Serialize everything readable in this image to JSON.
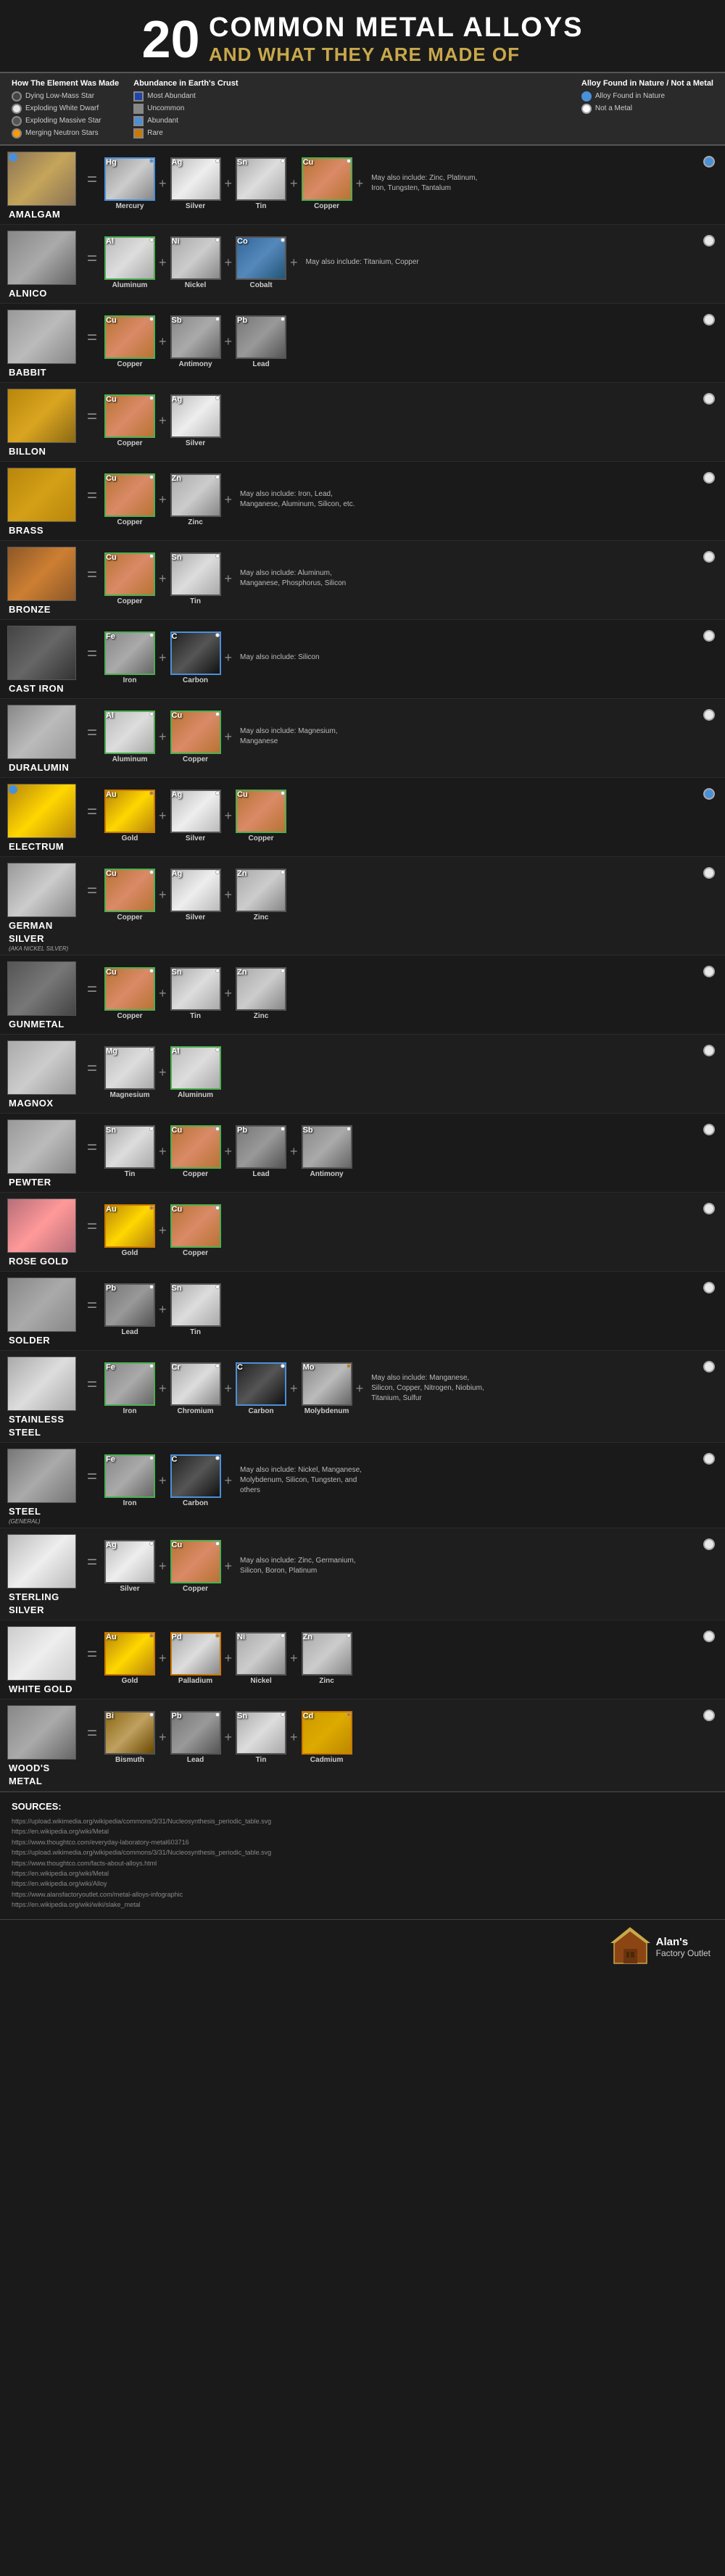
{
  "header": {
    "number": "20",
    "line1": "Common Metal Alloys",
    "line2": "And What They Are Made Of"
  },
  "legend": {
    "how_made_title": "How The Element Was Made",
    "items_how": [
      {
        "label": "Dying Low-Mass Star",
        "class": "lc-dying"
      },
      {
        "label": "Exploding White Dwarf",
        "class": "lc-dwarf"
      },
      {
        "label": "Exploding Massive Star",
        "class": "lc-massive"
      },
      {
        "label": "Merging Neutron Stars",
        "class": "lc-neutron"
      }
    ],
    "abundance_title": "Abundance in Earth's Crust",
    "items_abundance": [
      {
        "label": "Most Abundant",
        "class": "lb-most"
      },
      {
        "label": "Uncommon",
        "class": "lb-uncommon"
      },
      {
        "label": "Abundant",
        "class": "lb-abundant"
      },
      {
        "label": "Rare",
        "class": "lb-rare"
      }
    ],
    "alloy_found_title": "Alloy Found in Nature",
    "alloy_not_metal": "Not a Metal"
  },
  "alloys": [
    {
      "name": "AMALGAM",
      "subtitle": "",
      "texture": "tex-amalgam",
      "found_nature": true,
      "components": [
        {
          "symbol": "Hg",
          "name": "Mercury",
          "texture": "tex-mercury",
          "border": "border-blue",
          "dots": [
            "blue"
          ]
        },
        {
          "symbol": "Ag",
          "name": "Silver",
          "texture": "tex-silver",
          "border": "border-gray",
          "dots": [
            "white"
          ]
        },
        {
          "symbol": "Sn",
          "name": "Tin",
          "texture": "tex-tin",
          "border": "border-gray",
          "dots": [
            "white"
          ]
        },
        {
          "symbol": "Cu",
          "name": "Copper",
          "texture": "tex-copper",
          "border": "border-green",
          "dots": [
            "white"
          ]
        }
      ],
      "note": "May also include: Zinc, Platinum, Iron, Tungsten, Tantalum"
    },
    {
      "name": "ALNICO",
      "subtitle": "",
      "texture": "tex-alnico",
      "found_nature": false,
      "components": [
        {
          "symbol": "Al",
          "name": "Aluminum",
          "texture": "tex-aluminum",
          "border": "border-green",
          "dots": [
            "white"
          ]
        },
        {
          "symbol": "Ni",
          "name": "Nickel",
          "texture": "tex-nickel",
          "border": "border-gray",
          "dots": [
            "white"
          ]
        },
        {
          "symbol": "Co",
          "name": "Cobalt",
          "texture": "tex-cobalt",
          "border": "border-gray",
          "dots": [
            "white"
          ]
        }
      ],
      "note": "May also include: Titanium, Copper"
    },
    {
      "name": "BABBIT",
      "subtitle": "",
      "texture": "tex-babbit",
      "found_nature": false,
      "components": [
        {
          "symbol": "Cu",
          "name": "Copper",
          "texture": "tex-copper",
          "border": "border-green",
          "dots": [
            "white"
          ]
        },
        {
          "symbol": "Sb",
          "name": "Antimony",
          "texture": "tex-antimony",
          "border": "border-gray",
          "dots": [
            "white"
          ]
        },
        {
          "symbol": "Pb",
          "name": "Lead",
          "texture": "tex-lead",
          "border": "border-gray",
          "dots": [
            "white"
          ]
        }
      ],
      "note": ""
    },
    {
      "name": "BILLON",
      "subtitle": "",
      "texture": "tex-billon",
      "found_nature": false,
      "components": [
        {
          "symbol": "Cu",
          "name": "Copper",
          "texture": "tex-copper",
          "border": "border-green",
          "dots": [
            "white"
          ]
        },
        {
          "symbol": "Ag",
          "name": "Silver",
          "texture": "tex-silver",
          "border": "border-gray",
          "dots": [
            "white"
          ]
        }
      ],
      "note": ""
    },
    {
      "name": "BRASS",
      "subtitle": "",
      "texture": "tex-brass",
      "found_nature": false,
      "components": [
        {
          "symbol": "Cu",
          "name": "Copper",
          "texture": "tex-copper",
          "border": "border-green",
          "dots": [
            "white"
          ]
        },
        {
          "symbol": "Zn",
          "name": "Zinc",
          "texture": "tex-zinc",
          "border": "border-gray",
          "dots": [
            "white"
          ]
        }
      ],
      "note": "May also include: Iron, Lead, Manganese, Aluminum, Silicon, etc."
    },
    {
      "name": "BRONZE",
      "subtitle": "",
      "texture": "tex-bronze",
      "found_nature": false,
      "components": [
        {
          "symbol": "Cu",
          "name": "Copper",
          "texture": "tex-copper",
          "border": "border-green",
          "dots": [
            "white"
          ]
        },
        {
          "symbol": "Sn",
          "name": "Tin",
          "texture": "tex-tin",
          "border": "border-gray",
          "dots": [
            "white"
          ]
        }
      ],
      "note": "May also include: Aluminum, Manganese, Phosphorus, Silicon"
    },
    {
      "name": "CAST IRON",
      "subtitle": "",
      "texture": "tex-castiron",
      "found_nature": false,
      "components": [
        {
          "symbol": "Fe",
          "name": "Iron",
          "texture": "tex-iron",
          "border": "border-green",
          "dots": [
            "white"
          ]
        },
        {
          "symbol": "C",
          "name": "Carbon",
          "texture": "tex-carbon",
          "border": "border-blue",
          "dots": [
            "white"
          ]
        }
      ],
      "note": "May also include: Silicon"
    },
    {
      "name": "DURALUMIN",
      "subtitle": "",
      "texture": "tex-duralumin",
      "found_nature": false,
      "components": [
        {
          "symbol": "Al",
          "name": "Aluminum",
          "texture": "tex-aluminum",
          "border": "border-green",
          "dots": [
            "white"
          ]
        },
        {
          "symbol": "Cu",
          "name": "Copper",
          "texture": "tex-copper",
          "border": "border-green",
          "dots": [
            "white"
          ]
        }
      ],
      "note": "May also include: Magnesium, Manganese"
    },
    {
      "name": "ELECTRUM",
      "subtitle": "",
      "texture": "tex-electrum",
      "found_nature": true,
      "components": [
        {
          "symbol": "Au",
          "name": "Gold",
          "texture": "tex-gold",
          "border": "border-orange",
          "dots": [
            "orange"
          ]
        },
        {
          "symbol": "Ag",
          "name": "Silver",
          "texture": "tex-silver",
          "border": "border-gray",
          "dots": [
            "white"
          ]
        },
        {
          "symbol": "Cu",
          "name": "Copper",
          "texture": "tex-copper",
          "border": "border-green",
          "dots": [
            "white"
          ]
        }
      ],
      "note": ""
    },
    {
      "name": "GERMAN SILVER",
      "subtitle": "(AKA NICKEL SILVER)",
      "texture": "tex-germansilver",
      "found_nature": false,
      "components": [
        {
          "symbol": "Cu",
          "name": "Copper",
          "texture": "tex-copper",
          "border": "border-green",
          "dots": [
            "white"
          ]
        },
        {
          "symbol": "Ag",
          "name": "Silver",
          "texture": "tex-silver",
          "border": "border-gray",
          "dots": [
            "white"
          ]
        },
        {
          "symbol": "Zn",
          "name": "Zinc",
          "texture": "tex-zinc",
          "border": "border-gray",
          "dots": [
            "white"
          ]
        }
      ],
      "note": ""
    },
    {
      "name": "GUNMETAL",
      "subtitle": "",
      "texture": "tex-gunmetal",
      "found_nature": false,
      "components": [
        {
          "symbol": "Cu",
          "name": "Copper",
          "texture": "tex-copper",
          "border": "border-green",
          "dots": [
            "white"
          ]
        },
        {
          "symbol": "Sn",
          "name": "Tin",
          "texture": "tex-tin",
          "border": "border-gray",
          "dots": [
            "white"
          ]
        },
        {
          "symbol": "Zn",
          "name": "Zinc",
          "texture": "tex-zinc",
          "border": "border-gray",
          "dots": [
            "white"
          ]
        }
      ],
      "note": ""
    },
    {
      "name": "MAGNOX",
      "subtitle": "",
      "texture": "tex-magnox",
      "found_nature": false,
      "components": [
        {
          "symbol": "Mg",
          "name": "Magnesium",
          "texture": "tex-magnesium",
          "border": "border-gray",
          "dots": [
            "white"
          ]
        },
        {
          "symbol": "Al",
          "name": "Aluminum",
          "texture": "tex-aluminum",
          "border": "border-green",
          "dots": [
            "white"
          ]
        }
      ],
      "note": ""
    },
    {
      "name": "PEWTER",
      "subtitle": "",
      "texture": "tex-pewter",
      "found_nature": false,
      "components": [
        {
          "symbol": "Sn",
          "name": "Tin",
          "texture": "tex-tin",
          "border": "border-gray",
          "dots": [
            "white"
          ]
        },
        {
          "symbol": "Cu",
          "name": "Copper",
          "texture": "tex-copper",
          "border": "border-green",
          "dots": [
            "white"
          ]
        },
        {
          "symbol": "Pb",
          "name": "Lead",
          "texture": "tex-lead",
          "border": "border-gray",
          "dots": [
            "white"
          ]
        },
        {
          "symbol": "Sb",
          "name": "Antimony",
          "texture": "tex-antimony",
          "border": "border-gray",
          "dots": [
            "white"
          ]
        }
      ],
      "note": ""
    },
    {
      "name": "ROSE GOLD",
      "subtitle": "",
      "texture": "tex-rosegold",
      "found_nature": false,
      "components": [
        {
          "symbol": "Au",
          "name": "Gold",
          "texture": "tex-gold",
          "border": "border-orange",
          "dots": [
            "orange"
          ]
        },
        {
          "symbol": "Cu",
          "name": "Copper",
          "texture": "tex-copper",
          "border": "border-green",
          "dots": [
            "white"
          ]
        }
      ],
      "note": ""
    },
    {
      "name": "SOLDER",
      "subtitle": "",
      "texture": "tex-solder",
      "found_nature": false,
      "components": [
        {
          "symbol": "Pb",
          "name": "Lead",
          "texture": "tex-lead",
          "border": "border-gray",
          "dots": [
            "white"
          ]
        },
        {
          "symbol": "Sn",
          "name": "Tin",
          "texture": "tex-tin",
          "border": "border-gray",
          "dots": [
            "white"
          ]
        }
      ],
      "note": ""
    },
    {
      "name": "STAINLESS STEEL",
      "subtitle": "",
      "texture": "tex-stainless",
      "found_nature": false,
      "components": [
        {
          "symbol": "Fe",
          "name": "Iron",
          "texture": "tex-iron",
          "border": "border-green",
          "dots": [
            "white"
          ]
        },
        {
          "symbol": "Cr",
          "name": "Chromium",
          "texture": "tex-chromium",
          "border": "border-gray",
          "dots": [
            "white"
          ]
        },
        {
          "symbol": "C",
          "name": "Carbon",
          "texture": "tex-carbon",
          "border": "border-blue",
          "dots": [
            "white"
          ]
        },
        {
          "symbol": "Mo",
          "name": "Molybdenum",
          "texture": "tex-molybdenum",
          "border": "border-gray",
          "dots": [
            "orange"
          ]
        }
      ],
      "note": "May also include: Manganese, Silicon, Copper, Nitrogen, Niobium, Titanium, Sulfur"
    },
    {
      "name": "STEEL",
      "subtitle": "(GENERAL)",
      "texture": "tex-steel",
      "found_nature": false,
      "components": [
        {
          "symbol": "Fe",
          "name": "Iron",
          "texture": "tex-iron",
          "border": "border-green",
          "dots": [
            "white"
          ]
        },
        {
          "symbol": "C",
          "name": "Carbon",
          "texture": "tex-carbon",
          "border": "border-blue",
          "dots": [
            "white"
          ]
        }
      ],
      "note": "May also include: Nickel, Manganese, Molybdenum, Silicon, Tungsten, and others"
    },
    {
      "name": "STERLING SILVER",
      "subtitle": "",
      "texture": "tex-sterling",
      "found_nature": false,
      "components": [
        {
          "symbol": "Ag",
          "name": "Silver",
          "texture": "tex-silver",
          "border": "border-gray",
          "dots": [
            "white"
          ]
        },
        {
          "symbol": "Cu",
          "name": "Copper",
          "texture": "tex-copper",
          "border": "border-green",
          "dots": [
            "white"
          ]
        }
      ],
      "note": "May also include: Zinc, Germanium, Silicon, Boron, Platinum"
    },
    {
      "name": "WHITE GOLD",
      "subtitle": "",
      "texture": "tex-whitegold",
      "found_nature": false,
      "components": [
        {
          "symbol": "Au",
          "name": "Gold",
          "texture": "tex-gold",
          "border": "border-orange",
          "dots": [
            "orange"
          ]
        },
        {
          "symbol": "Pd",
          "name": "Palladium",
          "texture": "tex-palladium",
          "border": "border-orange",
          "dots": [
            "orange"
          ]
        },
        {
          "symbol": "Ni",
          "name": "Nickel",
          "texture": "tex-nickel",
          "border": "border-gray",
          "dots": [
            "white"
          ]
        },
        {
          "symbol": "Zn",
          "name": "Zinc",
          "texture": "tex-zinc",
          "border": "border-gray",
          "dots": [
            "white"
          ]
        }
      ],
      "note": ""
    },
    {
      "name": "WOOD'S METAL",
      "subtitle": "",
      "texture": "tex-woodsmetal",
      "found_nature": false,
      "components": [
        {
          "symbol": "Bi",
          "name": "Bismuth",
          "texture": "tex-bismuth",
          "border": "border-gray",
          "dots": [
            "white"
          ]
        },
        {
          "symbol": "Pb",
          "name": "Lead",
          "texture": "tex-lead",
          "border": "border-gray",
          "dots": [
            "white"
          ]
        },
        {
          "symbol": "Sn",
          "name": "Tin",
          "texture": "tex-tin",
          "border": "border-gray",
          "dots": [
            "white"
          ]
        },
        {
          "symbol": "Cd",
          "name": "Cadmium",
          "texture": "tex-cadmium",
          "border": "border-orange",
          "dots": [
            "orange"
          ]
        }
      ],
      "note": ""
    }
  ],
  "sources": {
    "title": "SOURCES:",
    "links": [
      "https://upload.wikimedia.org/wikipedia/commons/3/31/Nucleosynthesis_periodic_table.svg",
      "https://en.wikipedia.org/wiki/Metal",
      "https://www.thoughtco.com/everyday-laboratory-metal603716",
      "https://upload.wikimedia.org/wikipedia/commons/3/31/Nucleosynthesis_periodic_table.svg",
      "https://www.thoughtco.com/facts-about-alloys.html",
      "https://en.wikipedia.org/wiki/Metal",
      "https://en.wikipedia.org/wiki/Alloy",
      "https://www.alansfactoryoutlet.com/metal-alloys-infographic",
      "https://en.wikipedia.org/wiki/wiki/slake_metal"
    ]
  },
  "footer": {
    "logo_name": "Alan's",
    "logo_sub": "Factory Outlet"
  }
}
